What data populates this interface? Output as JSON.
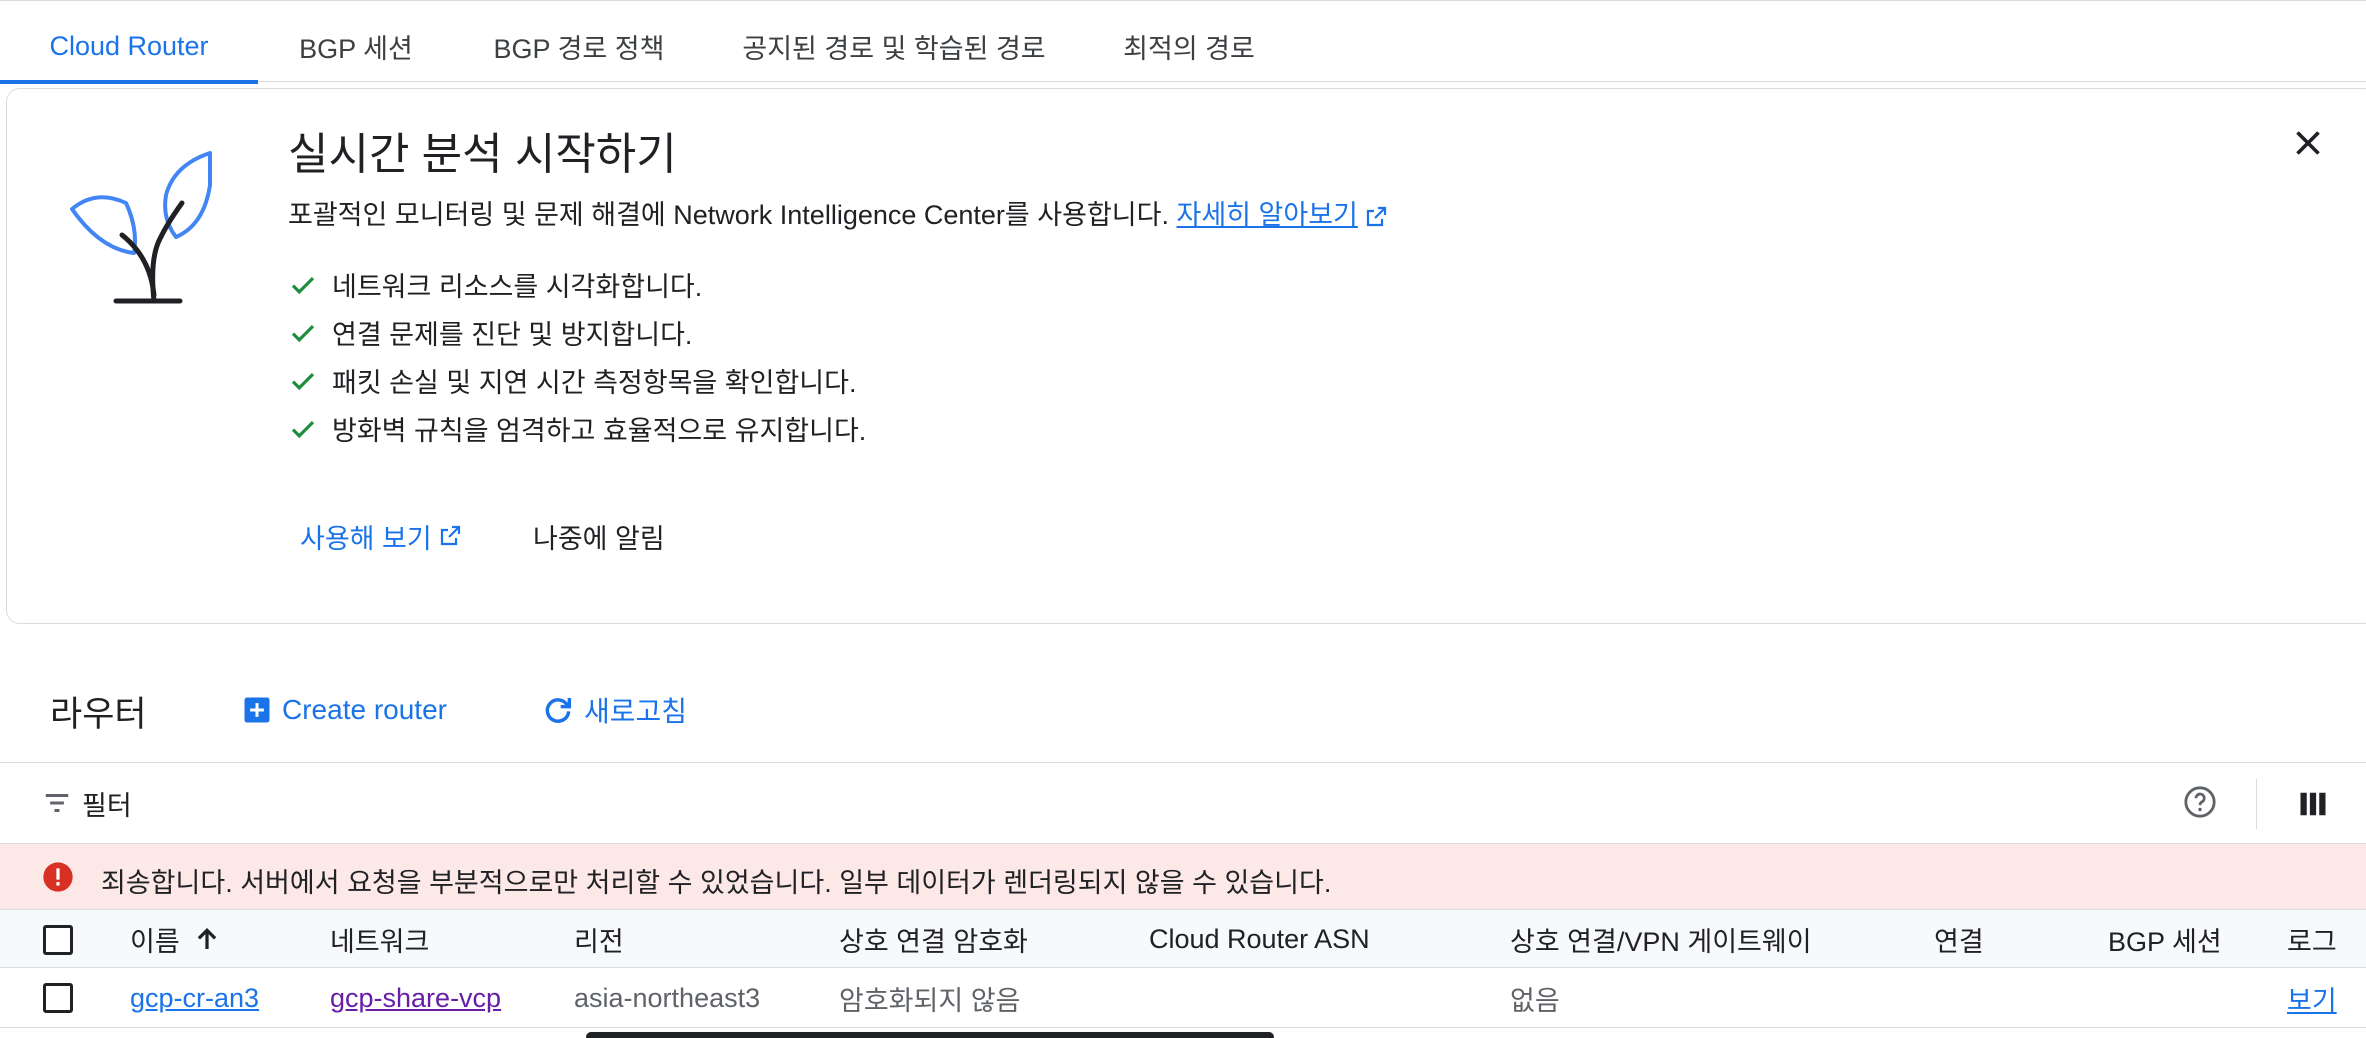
{
  "tabs": [
    {
      "label": "Cloud Router",
      "active": true
    },
    {
      "label": "BGP 세션",
      "active": false
    },
    {
      "label": "BGP 경로 정책",
      "active": false
    },
    {
      "label": "공지된 경로 및 학습된 경로",
      "active": false
    },
    {
      "label": "최적의 경로",
      "active": false
    }
  ],
  "banner": {
    "title": "실시간 분석 시작하기",
    "description": "포괄적인 모니터링 및 문제 해결에 Network Intelligence Center를 사용합니다.",
    "learn_more": "자세히 알아보기",
    "checklist": [
      "네트워크 리소스를 시각화합니다.",
      "연결 문제를 진단 및 방지합니다.",
      "패킷 손실 및 지연 시간 측정항목을 확인합니다.",
      "방화벽 규칙을 엄격하고 효율적으로 유지합니다."
    ],
    "try_label": "사용해 보기",
    "later_label": "나중에 알림",
    "accent_color": "#1a73e8",
    "check_color": "#1e8e3e"
  },
  "routers": {
    "title": "라우터",
    "create_label": "Create router",
    "refresh_label": "새로고침"
  },
  "filter": {
    "label": "필터"
  },
  "error": {
    "message": "죄송합니다. 서버에서 요청을 부분적으로만 처리할 수 있었습니다. 일부 데이터가 렌더링되지 않을 수 있습니다.",
    "color": "#d93025"
  },
  "table": {
    "columns": [
      "이름",
      "네트워크",
      "리전",
      "상호 연결 암호화",
      "Cloud Router ASN",
      "상호 연결/VPN 게이트웨이",
      "연결",
      "BGP 세션",
      "로그"
    ],
    "sort_column": "이름",
    "sort_direction": "ascending",
    "rows": [
      {
        "name": "gcp-cr-an3",
        "network": "gcp-share-vcp",
        "region": "asia-northeast3",
        "encryption": "암호화되지 않음",
        "asn": "",
        "gateway": "없음",
        "connection": "",
        "bgp": "",
        "logs": "보기"
      }
    ]
  }
}
